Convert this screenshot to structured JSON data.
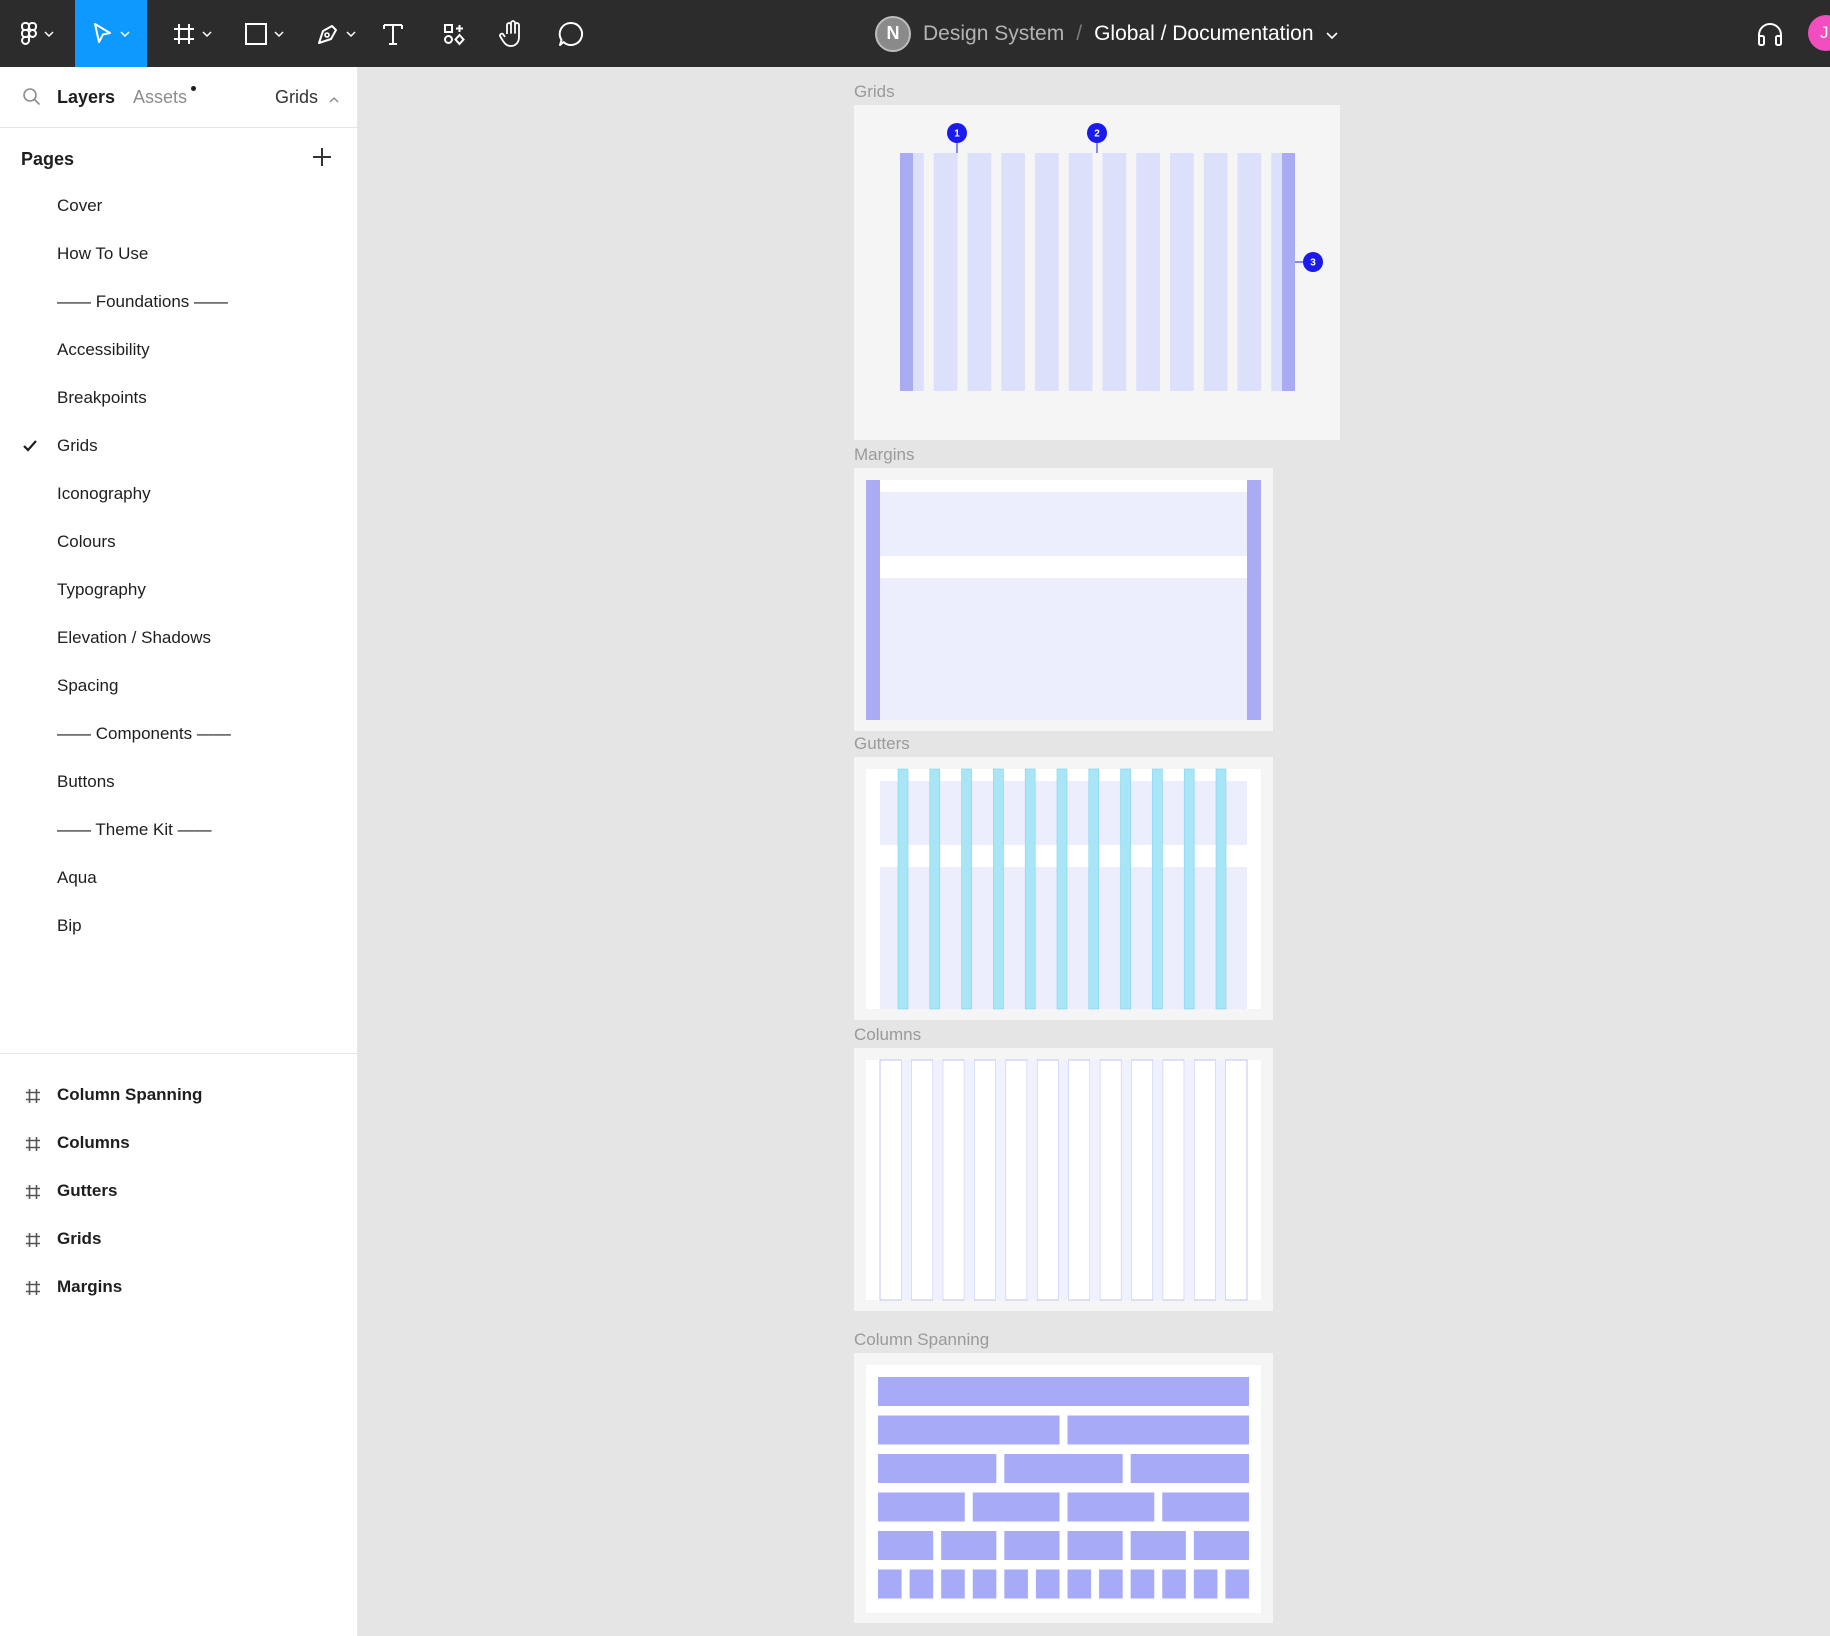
{
  "toolbar": {
    "team_initial": "N",
    "team": "Design System",
    "separator": "/",
    "file": "Global / Documentation",
    "user_initial": "J",
    "accent": "#0d99ff"
  },
  "panel": {
    "tabs": {
      "layers": "Layers",
      "assets": "Assets",
      "page_switch": "Grids"
    },
    "pages_header": "Pages",
    "pages": [
      "Cover",
      "How To Use",
      "—— Foundations ——",
      "Accessibility",
      "Breakpoints",
      "Grids",
      "Iconography",
      "Colours",
      "Typography",
      "Elevation / Shadows",
      "Spacing",
      "—— Components ——",
      "Buttons",
      "—— Theme Kit ——",
      "Aqua",
      "Bip"
    ],
    "current_page": "Grids",
    "layers": [
      "Column Spanning",
      "Columns",
      "Gutters",
      "Grids",
      "Margins"
    ]
  },
  "canvas": {
    "frames": {
      "grids": "Grids",
      "margins": "Margins",
      "gutters": "Gutters",
      "columns": "Columns",
      "spanning": "Column Spanning"
    },
    "markers": [
      "1",
      "2",
      "3"
    ],
    "column_count": 12,
    "span_rows": [
      1,
      2,
      3,
      4,
      6,
      12
    ],
    "colors": {
      "column": "#dde0fb",
      "column_edge": "#a9acf2",
      "marker": "#1a1aee",
      "gutter": "#a8e6f7",
      "span_block": "#a6aaf7"
    }
  }
}
